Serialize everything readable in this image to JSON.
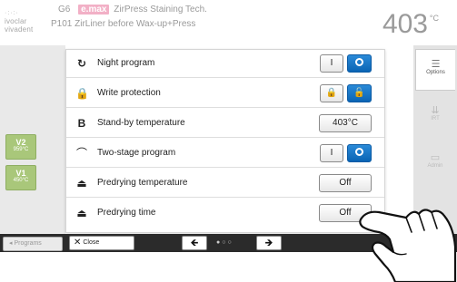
{
  "header": {
    "logo_line1": "ivoclar",
    "logo_line2": "vivadent",
    "device_code": "G6",
    "material_badge": "e.max",
    "program_name": "ZirPress Staining Tech.",
    "program_number": "P101",
    "program_desc": "ZirLiner before Wax-up+Press",
    "temperature": "403",
    "temperature_unit": "°C"
  },
  "background": {
    "hint_number": "2",
    "stages": [
      {
        "name": "V2",
        "temp": "959°C"
      },
      {
        "name": "V1",
        "temp": "450°C"
      }
    ]
  },
  "right_tabs": [
    {
      "label": "Options",
      "icon": "options-icon"
    },
    {
      "label": "IRT",
      "icon": "irt-icon"
    },
    {
      "label": "Admin",
      "icon": "admin-icon"
    }
  ],
  "options": [
    {
      "label": "Night program",
      "icon": "night-program-icon",
      "control": "toggle",
      "off_label": "I",
      "on_label": "O",
      "selected": "O"
    },
    {
      "label": "Write protection",
      "icon": "lock-icon",
      "control": "lock",
      "locked_glyph": "🔒",
      "unlocked_glyph": "🔓",
      "selected": "unlocked"
    },
    {
      "label": "Stand-by temperature",
      "icon": "standby-icon",
      "control": "value",
      "value": "403°C"
    },
    {
      "label": "Two-stage program",
      "icon": "two-stage-icon",
      "control": "toggle",
      "off_label": "I",
      "on_label": "O",
      "selected": "O"
    },
    {
      "label": "Predrying temperature",
      "icon": "predrying-icon",
      "control": "value",
      "value": "Off"
    },
    {
      "label": "Predrying time",
      "icon": "predrying-icon",
      "control": "value",
      "value": "Off"
    }
  ],
  "bottom_bar": {
    "programs_label": "Programs",
    "close_label": "Close",
    "prev_glyph": "🡸",
    "next_glyph": "🡺",
    "pager": "●○○"
  },
  "colors": {
    "accent_blue": "#0a64b4",
    "stage_green": "#a9c77a",
    "badge_pink": "#f2b0c6",
    "bottom_bar": "#2b2b2b"
  }
}
